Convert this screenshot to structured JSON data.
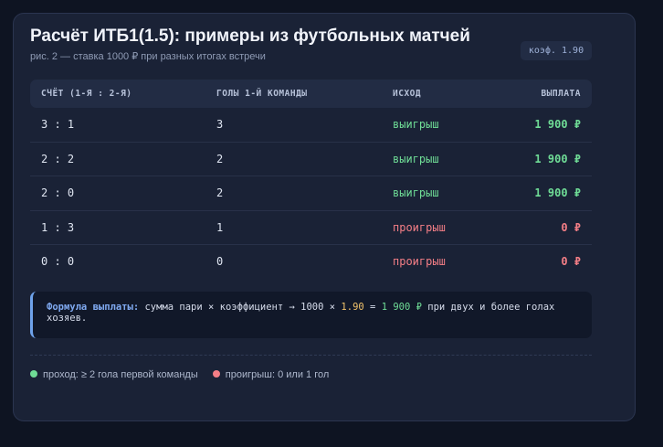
{
  "header": {
    "title": "Расчёт ИТБ1(1.5): примеры из футбольных матчей",
    "subtitle": "рис. 2 — ставка 1000 ₽ при разных итогах встречи",
    "badge": "коэф. 1.90"
  },
  "table": {
    "columns": [
      "СЧЁТ (1-Я : 2-Я)",
      "ГОЛЫ 1-Й КОМАНДЫ",
      "ИСХОД",
      "ВЫПЛАТА"
    ],
    "rows": [
      {
        "score": "3 : 1",
        "goals": "3",
        "outcome": "выигрыш",
        "payout": "1 900 ₽",
        "status": "win"
      },
      {
        "score": "2 : 2",
        "goals": "2",
        "outcome": "выигрыш",
        "payout": "1 900 ₽",
        "status": "win"
      },
      {
        "score": "2 : 0",
        "goals": "2",
        "outcome": "выигрыш",
        "payout": "1 900 ₽",
        "status": "win"
      },
      {
        "score": "1 : 3",
        "goals": "1",
        "outcome": "проигрыш",
        "payout": "0 ₽",
        "status": "lose"
      },
      {
        "score": "0 : 0",
        "goals": "0",
        "outcome": "проигрыш",
        "payout": "0 ₽",
        "status": "lose"
      }
    ]
  },
  "formula": {
    "label": "Формула выплаты:",
    "text_a": "сумма пари × коэффициент  →  1000 × ",
    "coef": "1.90",
    "text_b": " = ",
    "result": "1 900 ₽",
    "text_c": " при двух и более голах хозяев."
  },
  "legend": {
    "items": [
      {
        "label": "проход: ≥ 2 гола первой команды",
        "color": "#6fdc96"
      },
      {
        "label": "проигрыш: 0 или 1 гол",
        "color": "#f47e86"
      }
    ]
  },
  "colors": {
    "win": "#6fdc96",
    "lose": "#f47e86",
    "accent": "#6ea2ea",
    "coef": "#f1c36b"
  }
}
